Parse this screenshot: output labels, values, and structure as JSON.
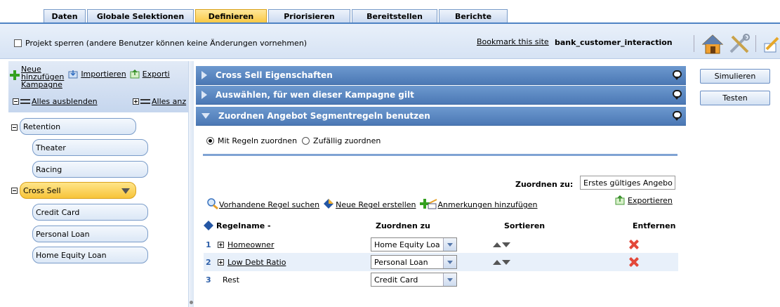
{
  "tabs": [
    "Daten",
    "Globale Selektionen",
    "Definieren",
    "Priorisieren",
    "Bereitstellen",
    "Berichte"
  ],
  "active_tab": "Definieren",
  "lock_label": "Projekt sperren (andere Benutzer können keine Änderungen vornehmen)",
  "bookmark_link": "Bookmark this site",
  "project_name": "bank_customer_interaction",
  "left": {
    "new_campaign_lines": [
      "Neue",
      "hinzufügen",
      "Kampagne"
    ],
    "import_label": "Importieren",
    "export_label": "Exporti",
    "collapse_all": "Alles ausblenden",
    "expand_all": "Alles anz"
  },
  "tree": [
    {
      "label": "Retention",
      "level": 0,
      "expanded": true,
      "selected": false
    },
    {
      "label": "Theater",
      "level": 1,
      "selected": false
    },
    {
      "label": "Racing",
      "level": 1,
      "selected": false
    },
    {
      "label": "Cross Sell",
      "level": 0,
      "expanded": true,
      "selected": true
    },
    {
      "label": "Credit Card",
      "level": 1,
      "selected": false
    },
    {
      "label": "Personal Loan",
      "level": 1,
      "selected": false
    },
    {
      "label": "Home Equity Loan",
      "level": 1,
      "selected": false
    }
  ],
  "sections": [
    {
      "title": "Cross Sell Eigenschaften",
      "expanded": false
    },
    {
      "title": "Auswählen, für wen dieser Kampagne gilt",
      "expanded": false
    },
    {
      "title": "Zuordnen Angebot Segmentregeln benutzen",
      "expanded": true
    }
  ],
  "radio": {
    "option1": "Mit Regeln zuordnen",
    "option2": "Zufällig zuordnen",
    "selected": "Mit Regeln zuordnen"
  },
  "assign": {
    "label": "Zuordnen zu:",
    "value": "Erstes gültiges Angebo"
  },
  "rule_actions": {
    "search": "Vorhandene Regel suchen",
    "create": "Neue Regel erstellen",
    "notes": "Anmerkungen hinzufügen",
    "export": "Exportieren"
  },
  "table": {
    "columns": [
      "Regelname -",
      "Zuordnen zu",
      "Sortieren",
      "Entfernen"
    ],
    "rows": [
      {
        "num": "1",
        "name": "Homeowner",
        "assign": "Home Equity Loa",
        "expandable": true,
        "sortable": true,
        "removable": true
      },
      {
        "num": "2",
        "name": "Low Debt Ratio",
        "assign": "Personal Loan",
        "expandable": true,
        "sortable": true,
        "removable": true
      },
      {
        "num": "3",
        "name": "Rest",
        "assign": "Credit Card",
        "expandable": false,
        "sortable": false,
        "removable": false
      }
    ]
  },
  "buttons": {
    "simulate": "Simulieren",
    "test": "Testen"
  },
  "colors": {
    "accent_tab": "#f9c740",
    "header_blue": "#5a86c2",
    "remove_red": "#e3483a"
  }
}
